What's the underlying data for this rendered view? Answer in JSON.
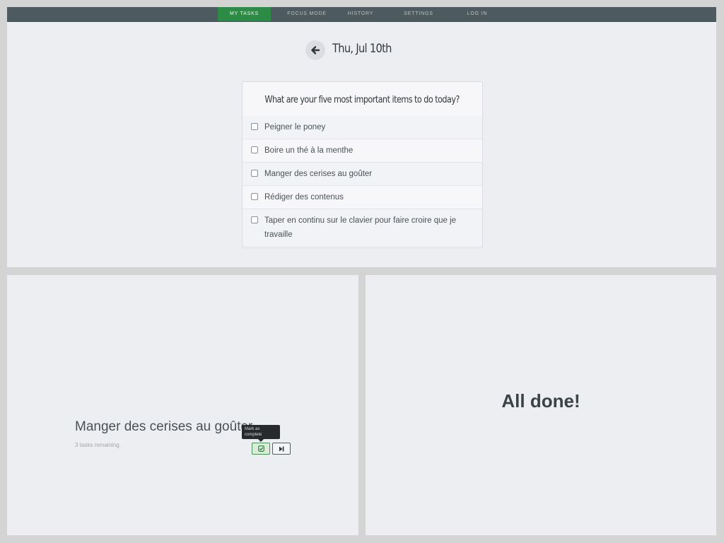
{
  "nav": {
    "items": [
      {
        "label": "MY TASKS",
        "active": true
      },
      {
        "label": "FOCUS MODE",
        "active": false
      },
      {
        "label": "HISTORY",
        "active": false
      },
      {
        "label": "SETTINGS",
        "active": false
      },
      {
        "label": "LOG IN",
        "active": false
      }
    ]
  },
  "header": {
    "date": "Thu, Jul 10th",
    "back_icon": "arrow-left-icon"
  },
  "card": {
    "question": "What are your five most important items to do today?",
    "tasks": [
      {
        "label": "Peigner le poney",
        "checked": false
      },
      {
        "label": "Boire un thé à la menthe",
        "checked": false
      },
      {
        "label": "Manger des cerises au goûter",
        "checked": false
      },
      {
        "label": "Rédiger des contenus",
        "checked": false
      },
      {
        "label": "Taper en continu sur le clavier pour faire croire que je travaille",
        "checked": false
      }
    ]
  },
  "focus": {
    "task": "Manger des cerises au goûter",
    "remaining": "3 tasks remaining.",
    "tooltip": "Mark as complete",
    "complete_icon": "check-square-icon",
    "skip_icon": "skip-forward-icon"
  },
  "done": {
    "message": "All done!"
  },
  "colors": {
    "nav_bg": "#4d5a60",
    "nav_active": "#2c8b45",
    "panel_bg": "#edeef2",
    "text_dark": "#333b3f"
  }
}
